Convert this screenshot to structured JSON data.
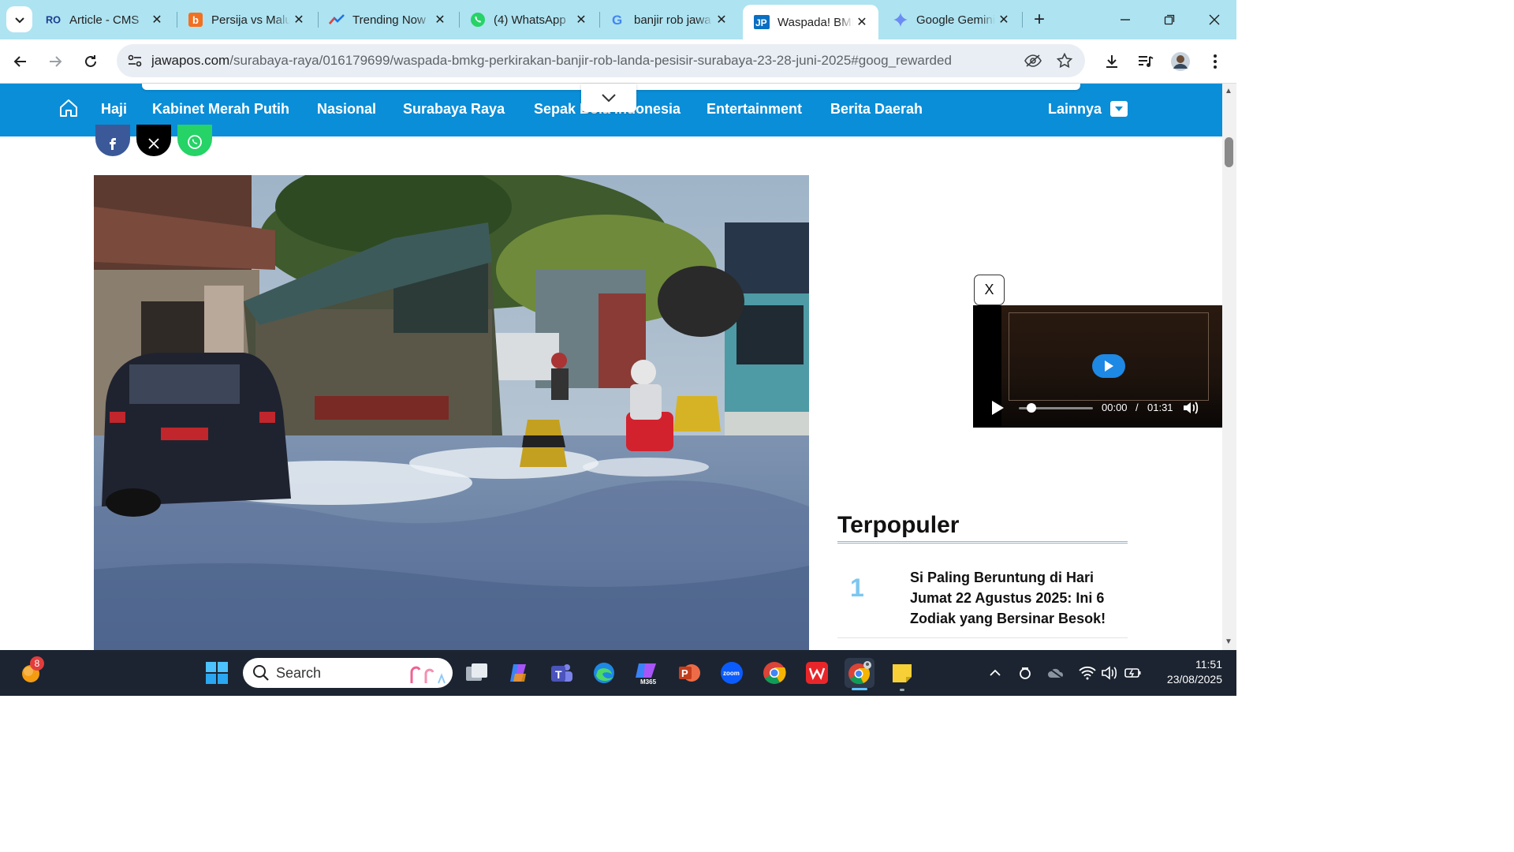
{
  "browser": {
    "tabs": [
      {
        "title": "Article - CMS",
        "icon": "cms-logo-icon"
      },
      {
        "title": "Persija vs Malut",
        "icon": "bing-icon"
      },
      {
        "title": "Trending Now",
        "icon": "trends-icon"
      },
      {
        "title": "(4) WhatsApp",
        "icon": "whatsapp-icon"
      },
      {
        "title": "banjir rob jawa",
        "icon": "google-icon"
      },
      {
        "title": "Waspada! BMKG",
        "icon": "jawapos-icon",
        "active": true
      },
      {
        "title": "Google Gemini",
        "icon": "gemini-icon"
      }
    ],
    "new_tab": "+",
    "url_host": "jawapos.com",
    "url_path": "/surabaya-raya/016179699/waspada-bmkg-perkirakan-banjir-rob-landa-pesisir-surabaya-23-28-juni-2025#goog_rewarded"
  },
  "sitenav": {
    "items": [
      "Haji",
      "Kabinet Merah Putih",
      "Nasional",
      "Surabaya Raya",
      "Sepak Bola Indonesia",
      "Entertainment",
      "Berita Daerah"
    ],
    "more": "Lainnya"
  },
  "video": {
    "close": "X",
    "current": "00:00",
    "separator": "/",
    "duration": "01:31",
    "progress": 0.0
  },
  "sidebar": {
    "title": "Terpopuler",
    "items": [
      {
        "rank": "1",
        "title": "Si Paling Beruntung di Hari Jumat 22 Agustus 2025: Ini 6 Zodiak yang Bersinar Besok!"
      }
    ]
  },
  "taskbar": {
    "search": "Search",
    "notification_count": "8",
    "time": "11:51",
    "date": "23/08/2025"
  },
  "colors": {
    "tabstrip": "#aee3f1",
    "sitenav": "#0a8ed8",
    "taskbar": "#1c2431"
  }
}
